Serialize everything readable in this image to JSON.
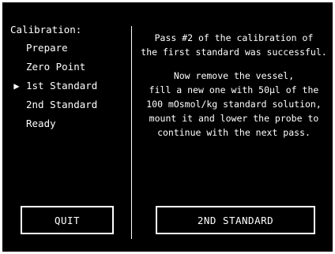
{
  "sidebar": {
    "title": "Calibration:",
    "current_marker": "▶",
    "items": [
      {
        "label": "Prepare",
        "current": false
      },
      {
        "label": "Zero Point",
        "current": false
      },
      {
        "label": "1st Standard",
        "current": true
      },
      {
        "label": "2nd Standard",
        "current": false
      },
      {
        "label": "Ready",
        "current": false
      }
    ]
  },
  "message": {
    "paragraph1": [
      "Pass #2 of the calibration of",
      "the first standard was successful."
    ],
    "paragraph2": [
      "Now remove the vessel,",
      "fill a new one with 50µl of the",
      "100 mOsmol/kg standard solution,",
      "mount it and lower the probe to",
      "continue with the next pass."
    ]
  },
  "buttons": {
    "quit_label": "QUIT",
    "next_label": "2ND STANDARD"
  },
  "colors": {
    "background": "#000000",
    "foreground": "#ffffff"
  }
}
